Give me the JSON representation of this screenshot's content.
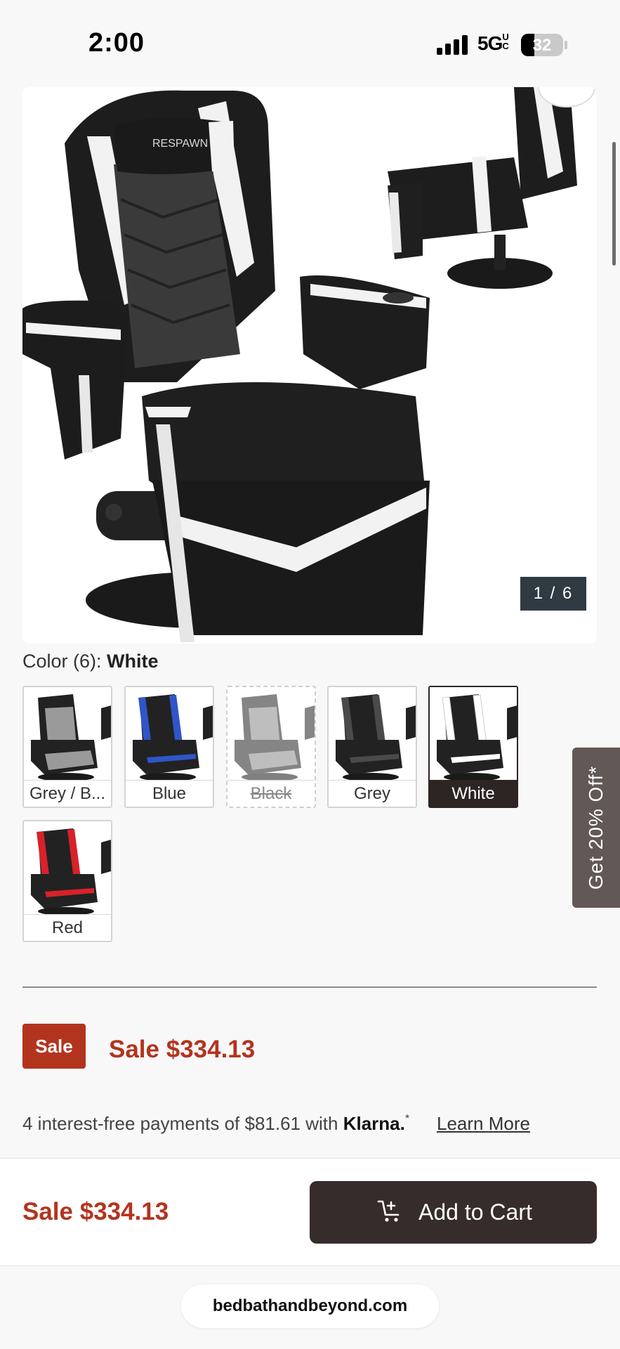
{
  "status_bar": {
    "time": "2:00",
    "network": "5G",
    "network_superscript": "UC",
    "battery_level": "32",
    "battery_fraction": 0.32
  },
  "gallery": {
    "brand_on_chair": "RESPAWN",
    "counter": "1 / 6"
  },
  "color_selector": {
    "label": "Color (6):",
    "selected": "White",
    "options": [
      {
        "label": "Grey / B...",
        "state": "available",
        "accent": "#9a9a9a"
      },
      {
        "label": "Blue",
        "state": "available",
        "accent": "#2f55c8"
      },
      {
        "label": "Black",
        "state": "unavailable",
        "accent": "#8a8a8a"
      },
      {
        "label": "Grey",
        "state": "available",
        "accent": "#4a4a4a"
      },
      {
        "label": "White",
        "state": "selected",
        "accent": "#ffffff"
      },
      {
        "label": "Red",
        "state": "available",
        "accent": "#d8222a"
      }
    ]
  },
  "promo_tab": "Get 20% Off*",
  "pricing": {
    "badge": "Sale",
    "price": "Sale $334.13"
  },
  "klarna": {
    "text": "4 interest-free payments of $81.61 with",
    "logo": "Klarna.",
    "asterisk": "*",
    "learn_more": "Learn More"
  },
  "bottom_bar": {
    "price": "Sale $334.13",
    "add_to_cart": "Add to Cart",
    "cart_icon": "cart-plus-icon"
  },
  "browser": {
    "url": "bedbathandbeyond.com"
  },
  "colors": {
    "sale_red": "#b3341e",
    "dark_button": "#372c2c",
    "promo_tab": "#625856"
  }
}
